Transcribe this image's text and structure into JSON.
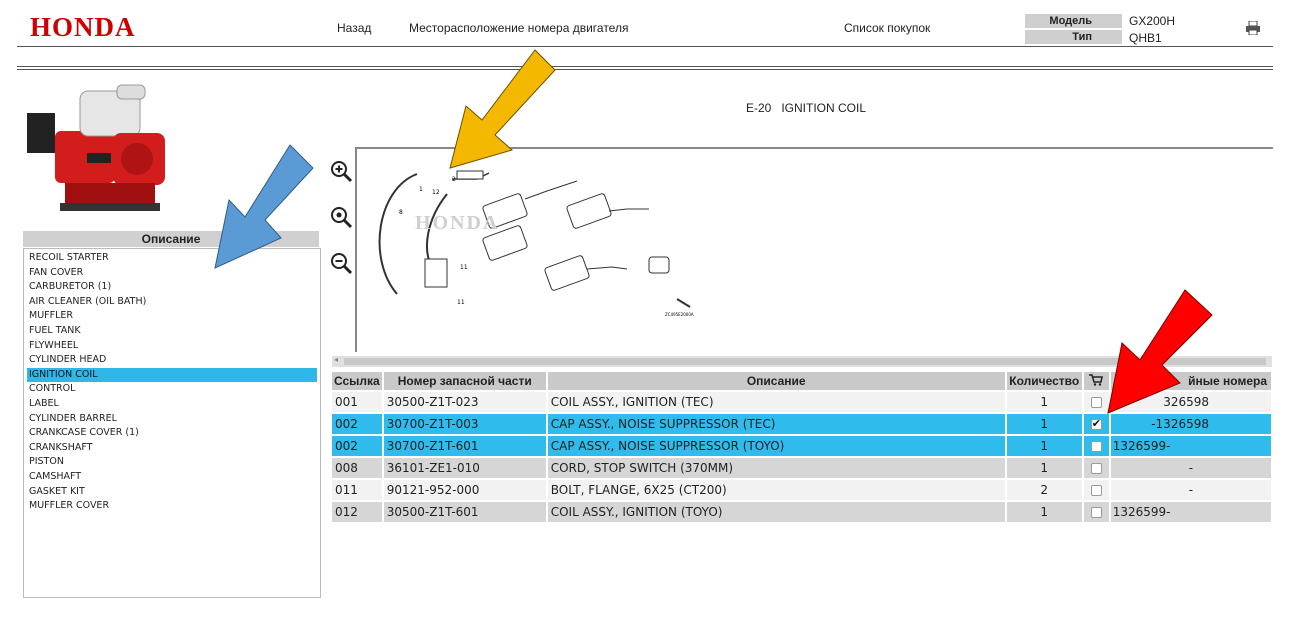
{
  "header": {
    "logo": "HONDA",
    "nav": {
      "back": "Назад",
      "engine_number_location": "Месторасположение номера двигателя",
      "shopping_list": "Список покупок"
    },
    "model_label": "Модель",
    "model_value": "GX200H",
    "type_label": "Тип",
    "type_value": "QHB1"
  },
  "sidebar": {
    "header": "Описание",
    "items": [
      {
        "label": "RECOIL STARTER"
      },
      {
        "label": "FAN COVER"
      },
      {
        "label": "CARBURETOR (1)"
      },
      {
        "label": "AIR CLEANER (OIL BATH)"
      },
      {
        "label": "MUFFLER"
      },
      {
        "label": "FUEL TANK"
      },
      {
        "label": "FLYWHEEL"
      },
      {
        "label": "CYLINDER HEAD"
      },
      {
        "label": "IGNITION COIL",
        "selected": true
      },
      {
        "label": "CONTROL"
      },
      {
        "label": "LABEL"
      },
      {
        "label": "CYLINDER BARREL"
      },
      {
        "label": "CRANKCASE COVER (1)"
      },
      {
        "label": "CRANKSHAFT"
      },
      {
        "label": "PISTON"
      },
      {
        "label": "CAMSHAFT"
      },
      {
        "label": "GASKET KIT"
      },
      {
        "label": "MUFFLER COVER"
      }
    ]
  },
  "diagram": {
    "title": "E-20   IGNITION COIL",
    "watermark": "HONDA",
    "code": "ZC495E2000A"
  },
  "table": {
    "headers": {
      "ref": "Ссылка",
      "part_number": "Номер запасной части",
      "description": "Описание",
      "quantity": "Количество",
      "cart_icon": "cart-icon",
      "serial": "Серийные номера",
      "serial_visible": "йные номера"
    },
    "rows": [
      {
        "ref": "001",
        "part": "30500-Z1T-023",
        "desc": "COIL ASSY., IGNITION (TEC)",
        "qty": "1",
        "checked": false,
        "serial": "-1326598",
        "serial_visible": "326598",
        "style": "light"
      },
      {
        "ref": "002",
        "part": "30700-Z1T-003",
        "desc": "CAP ASSY., NOISE SUPPRESSOR (TEC)",
        "qty": "1",
        "checked": true,
        "serial": "-1326598",
        "serial_visible": "-1326598",
        "style": "sel"
      },
      {
        "ref": "002",
        "part": "30700-Z1T-601",
        "desc": "CAP ASSY., NOISE SUPPRESSOR (TOYO)",
        "qty": "1",
        "checked": false,
        "serial": "1326599-",
        "serial_visible": "1326599-",
        "style": "sel"
      },
      {
        "ref": "008",
        "part": "36101-ZE1-010",
        "desc": "CORD, STOP SWITCH (370MM)",
        "qty": "1",
        "checked": false,
        "serial": "-",
        "serial_visible": "-",
        "style": "dark"
      },
      {
        "ref": "011",
        "part": "90121-952-000",
        "desc": "BOLT, FLANGE, 6X25 (CT200)",
        "qty": "2",
        "checked": false,
        "serial": "-",
        "serial_visible": "-",
        "style": "light"
      },
      {
        "ref": "012",
        "part": "30500-Z1T-601",
        "desc": "COIL ASSY., IGNITION (TOYO)",
        "qty": "1",
        "checked": false,
        "serial": "1326599-",
        "serial_visible": "1326599-",
        "style": "dark"
      }
    ]
  },
  "icons": {
    "printer": "printer-icon",
    "zoom_in": "zoom-in-icon",
    "zoom_reset": "zoom-reset-icon",
    "zoom_out": "zoom-out-icon"
  },
  "annotation_colors": {
    "orange_arrow": "#f5b800",
    "blue_arrow": "#5b9bd5",
    "red_arrow": "#ff0000"
  }
}
